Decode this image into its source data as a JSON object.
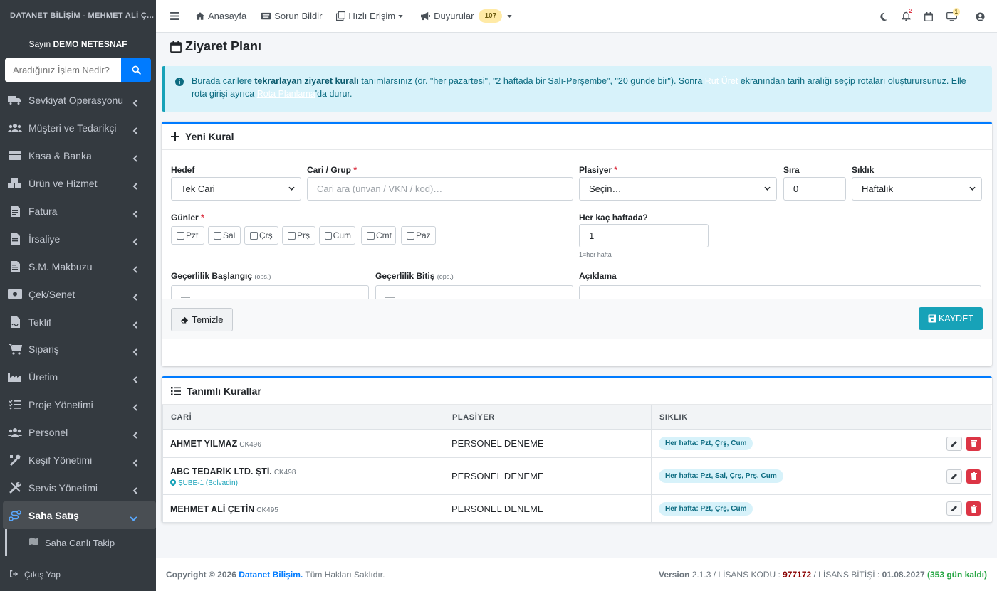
{
  "sidebar": {
    "brand": "DATANET BİLİŞİM - MEHMET ALİ Ç...",
    "greeting_prefix": "Sayın",
    "user": "DEMO NETESNAF",
    "search_placeholder": "Aradığınız İşlem Nedir?",
    "items": [
      {
        "label": "Sevkiyat Operasyonu",
        "icon": "truck-icon"
      },
      {
        "label": "Müşteri ve Tedarikçi",
        "icon": "users-icon"
      },
      {
        "label": "Kasa & Banka",
        "icon": "wallet-icon"
      },
      {
        "label": "Ürün ve Hizmet",
        "icon": "boxes-icon"
      },
      {
        "label": "Fatura",
        "icon": "invoice-icon"
      },
      {
        "label": "İrsaliye",
        "icon": "file-icon"
      },
      {
        "label": "S.M. Makbuzu",
        "icon": "receipt-icon"
      },
      {
        "label": "Çek/Senet",
        "icon": "money-bill-icon"
      },
      {
        "label": "Teklif",
        "icon": "file-signature-icon"
      },
      {
        "label": "Sipariş",
        "icon": "cart-icon"
      },
      {
        "label": "Üretim",
        "icon": "industry-icon"
      },
      {
        "label": "Proje Yönetimi",
        "icon": "tasks-icon"
      },
      {
        "label": "Personel",
        "icon": "users-cog-icon"
      },
      {
        "label": "Keşif Yönetimi",
        "icon": "tools-icon"
      },
      {
        "label": "Servis Yönetimi",
        "icon": "wrench-icon"
      },
      {
        "label": "Saha Satış",
        "icon": "route-icon"
      }
    ],
    "sub_item": "Saha Canlı Takip",
    "logout": "Çıkış Yap"
  },
  "topbar": {
    "home": "Anasayfa",
    "report": "Sorun Bildir",
    "quick": "Hızlı Erişim",
    "announcements": "Duyurular",
    "announcements_count": "107",
    "notif_count": "2",
    "screen_count": "1"
  },
  "page": {
    "title": "Ziyaret Planı",
    "alert": {
      "t1": "Burada carilere ",
      "b1": "tekrarlayan ziyaret kuralı",
      "t2": " tanımlarsınız (ör. \"her pazartesi\", \"2 haftada bir Salı-Perşembe\", \"20 günde bir\"). Sonra ",
      "link1": "Rut Üret",
      "t3": " ekranından tarih aralığı seçip rotaları oluşturursunuz. Elle rota girişi ayrıca ",
      "link2": "Rota Planlama",
      "t4": "'da durur."
    }
  },
  "form": {
    "title": "Yeni Kural",
    "target_label": "Hedef",
    "target_value": "Tek Cari",
    "cari_label": "Cari / Grup",
    "cari_placeholder": "Cari ara (ünvan / VKN / kod)…",
    "rep_label": "Plasiyer",
    "rep_value": "Seçin…",
    "order_label": "Sıra",
    "order_value": "0",
    "freq_label": "Sıklık",
    "freq_value": "Haftalık",
    "days_label": "Günler",
    "days": [
      "Pzt",
      "Sal",
      "Çrş",
      "Prş",
      "Cum",
      "Cmt",
      "Paz"
    ],
    "weeks_label": "Her kaç haftada?",
    "weeks_value": "1",
    "weeks_hint": "1=her hafta",
    "start_label": "Geçerlilik Başlangıç",
    "end_label": "Geçerlilik Bitiş",
    "optional": "(ops.)",
    "date_placeholder": "—",
    "note_label": "Açıklama",
    "clear_button": "Temizle",
    "save_button": "KAYDET",
    "required_mark": "*"
  },
  "rules": {
    "title": "Tanımlı Kurallar",
    "columns": [
      "CARİ",
      "PLASİYER",
      "SIKLIK",
      ""
    ],
    "rows": [
      {
        "name": "AHMET YILMAZ",
        "code": "CK496",
        "branch": "",
        "rep": "PERSONEL DENEME",
        "freq": "Her hafta: Pzt, Çrş, Cum"
      },
      {
        "name": "ABC TEDARİK LTD. ŞTİ.",
        "code": "CK498",
        "branch": "ŞUBE-1 (Bolvadin)",
        "rep": "PERSONEL DENEME",
        "freq": "Her hafta: Pzt, Sal, Çrş, Prş, Cum"
      },
      {
        "name": "MEHMET ALİ ÇETİN",
        "code": "CK495",
        "branch": "",
        "rep": "PERSONEL DENEME",
        "freq": "Her hafta: Pzt, Çrş, Cum"
      }
    ]
  },
  "footer": {
    "copyright": "Copyright © 2026",
    "company": "Datanet Bilişim.",
    "rights": "Tüm Hakları Saklıdır.",
    "version_label": "Version",
    "version": "2.1.3",
    "license_label": "/ LİSANS KODU :",
    "license_code": "977172",
    "expiry_label": "/ LİSANS BİTİŞİ :",
    "expiry_date": "01.08.2027",
    "days_left": "(353 gün kaldı)"
  },
  "colors": {
    "primary": "#007bff",
    "info": "#17a2b8",
    "danger": "#dc3545",
    "sidebar": "#343a40"
  }
}
